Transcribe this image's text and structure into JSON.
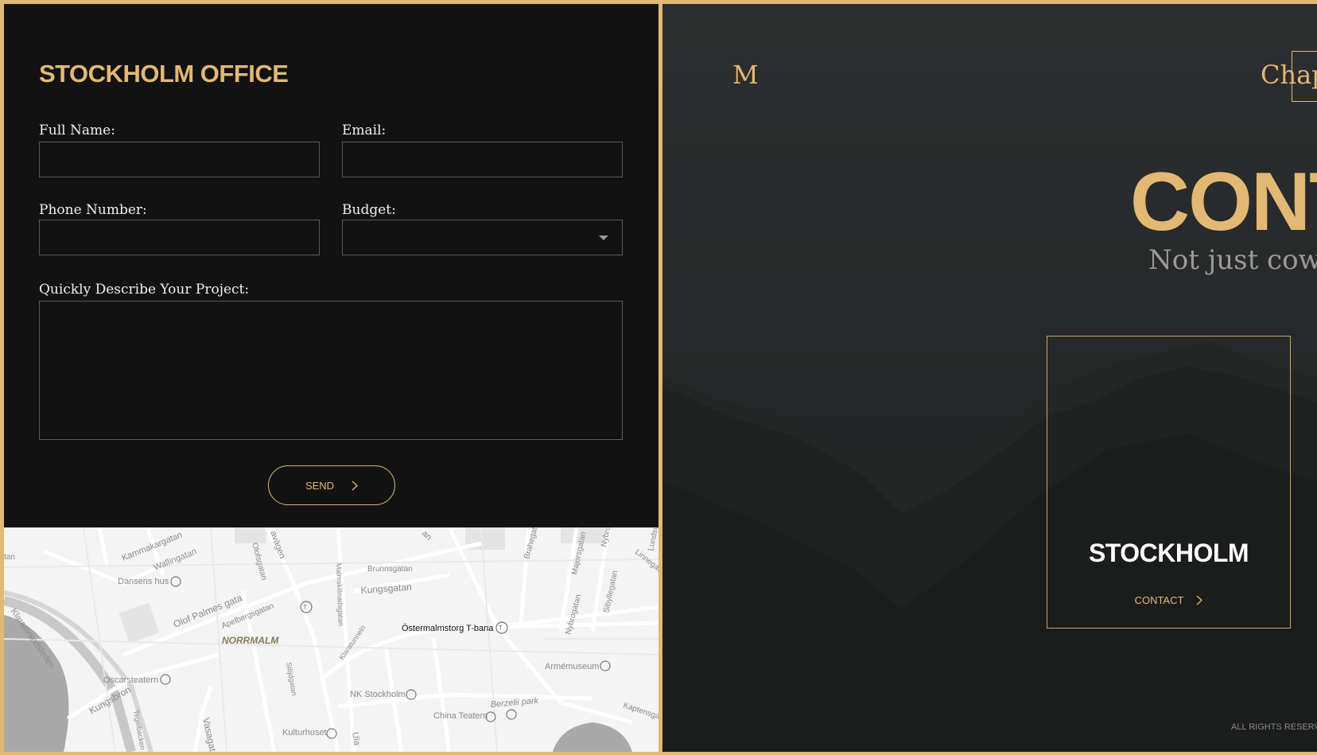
{
  "form": {
    "title": "STOCKHOLM OFFICE",
    "full_name_label": "Full Name:",
    "email_label": "Email:",
    "phone_label": "Phone Number:",
    "budget_label": "Budget:",
    "project_label": "Quickly Describe Your Project:",
    "full_name_value": "",
    "email_value": "",
    "phone_value": "",
    "budget_value": "",
    "project_value": "",
    "send_label": "SEND"
  },
  "map": {
    "labels": {
      "kammakargatan": "Kammakargatan",
      "wallingatan": "Wallingatan",
      "dansens_hus": "Dansens hus",
      "olof_palmes_gata": "Olof Palmes gata",
      "apelbergsgatan": "Apelbergsgatan",
      "olofsgatan": "Olofsgatan",
      "vagen": "avägen",
      "brunnsgatan": "Brunnsgatan",
      "kungsgatan": "Kungsgatan",
      "malmskillnadsgatan": "Malmskillnadsgatan",
      "ostermalmstorg": "Östermalmstorg T-bana",
      "norrmalm": "NORRMALM",
      "klarastrandsleden": "Klarastrandsleden",
      "oscarsteatern": "Oscarsteatern",
      "kungsbron": "Kungsbron",
      "sibyllegatan": "Sibyllegatan",
      "nybrogatan": "Nybrogatan",
      "majorsgatan": "Majorsgatan",
      "brahegatan": "Brahegatan",
      "linnegatan": "Linnegatan",
      "armemuseum": "Armémuseum",
      "klaratunneln": "Klaratunneln",
      "sloydgatan": "Slöjdgatan",
      "nk_stockholm": "NK Stockholm",
      "berzelii_park": "Berzelii park",
      "china_teatern": "China Teatern",
      "kaptensgatan": "Kaptensgatan",
      "kulturhuset": "Kulturhuset",
      "vasagatan": "Vasagatan",
      "tegelbacken": "Tegelbacken",
      "ula": "Ula",
      "an": "an",
      "tan": "tan",
      "nybro": "Nybro",
      "landsv": "Lundsv"
    }
  },
  "hero": {
    "logo_letter": "M",
    "nav_text": "Chap",
    "heading": "CONT",
    "subtitle": "Not just cowor",
    "card": {
      "city": "STOCKHOLM",
      "link_label": "CONTACT"
    },
    "footer": "ALL RIGHTS RESERV"
  },
  "colors": {
    "accent": "#e3b874",
    "panel_dark": "#121212",
    "field_border": "#5a5a5a",
    "hero_bg": "#262829"
  },
  "icons": {
    "send_arrow": "chevron-right-icon",
    "select_caret": "caret-down-icon",
    "contact_arrow": "chevron-right-icon"
  }
}
